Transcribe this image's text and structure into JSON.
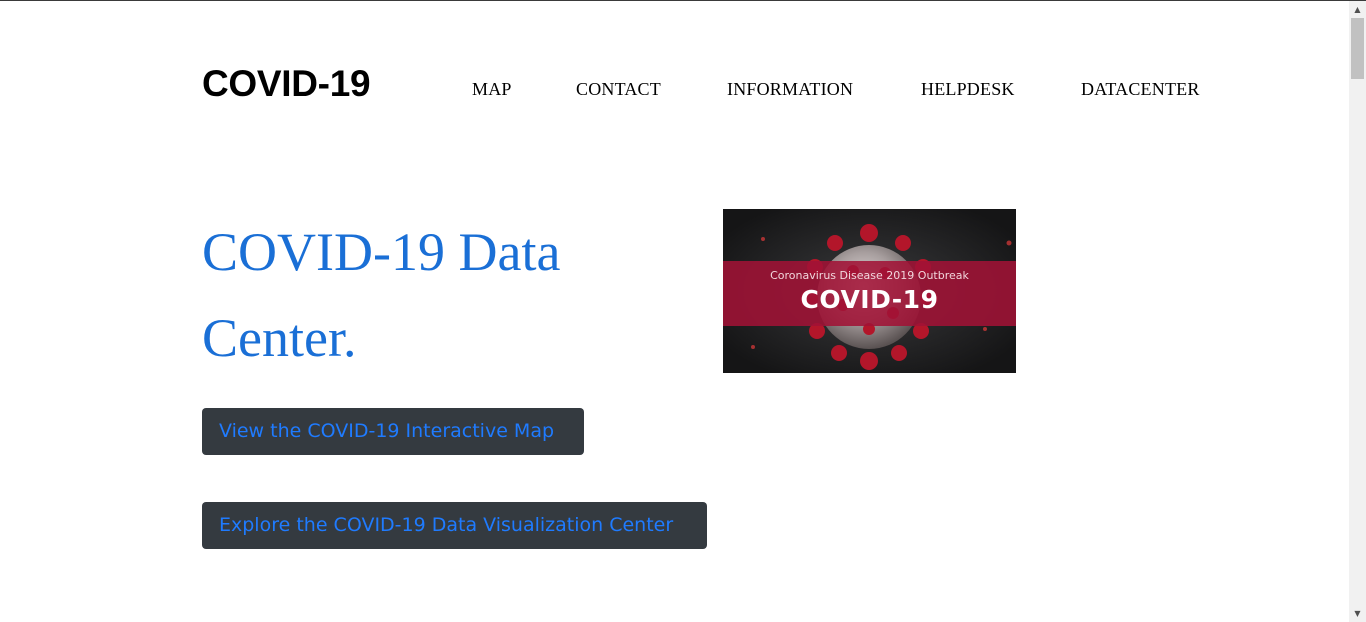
{
  "header": {
    "logo": "COVID-19",
    "nav": [
      {
        "label": "MAP"
      },
      {
        "label": "CONTACT"
      },
      {
        "label": "INFORMATION"
      },
      {
        "label": "HELPDESK"
      },
      {
        "label": "DATACENTER"
      }
    ]
  },
  "hero": {
    "title": "COVID-19 Data Center.",
    "buttons": {
      "map": "View the COVID-19 Interactive Map",
      "viz": "Explore the COVID-19 Data Visualization Center"
    },
    "image": {
      "subtitle": "Coronavirus Disease 2019 Outbreak",
      "title": "COVID-19"
    }
  },
  "colors": {
    "title_blue": "#1a6fd6",
    "button_bg": "#343a40",
    "button_text": "#1f7bff",
    "banner_red": "#a01236"
  },
  "icons": {
    "scroll_up": "scroll-up-arrow-icon",
    "scroll_down": "scroll-down-arrow-icon"
  }
}
